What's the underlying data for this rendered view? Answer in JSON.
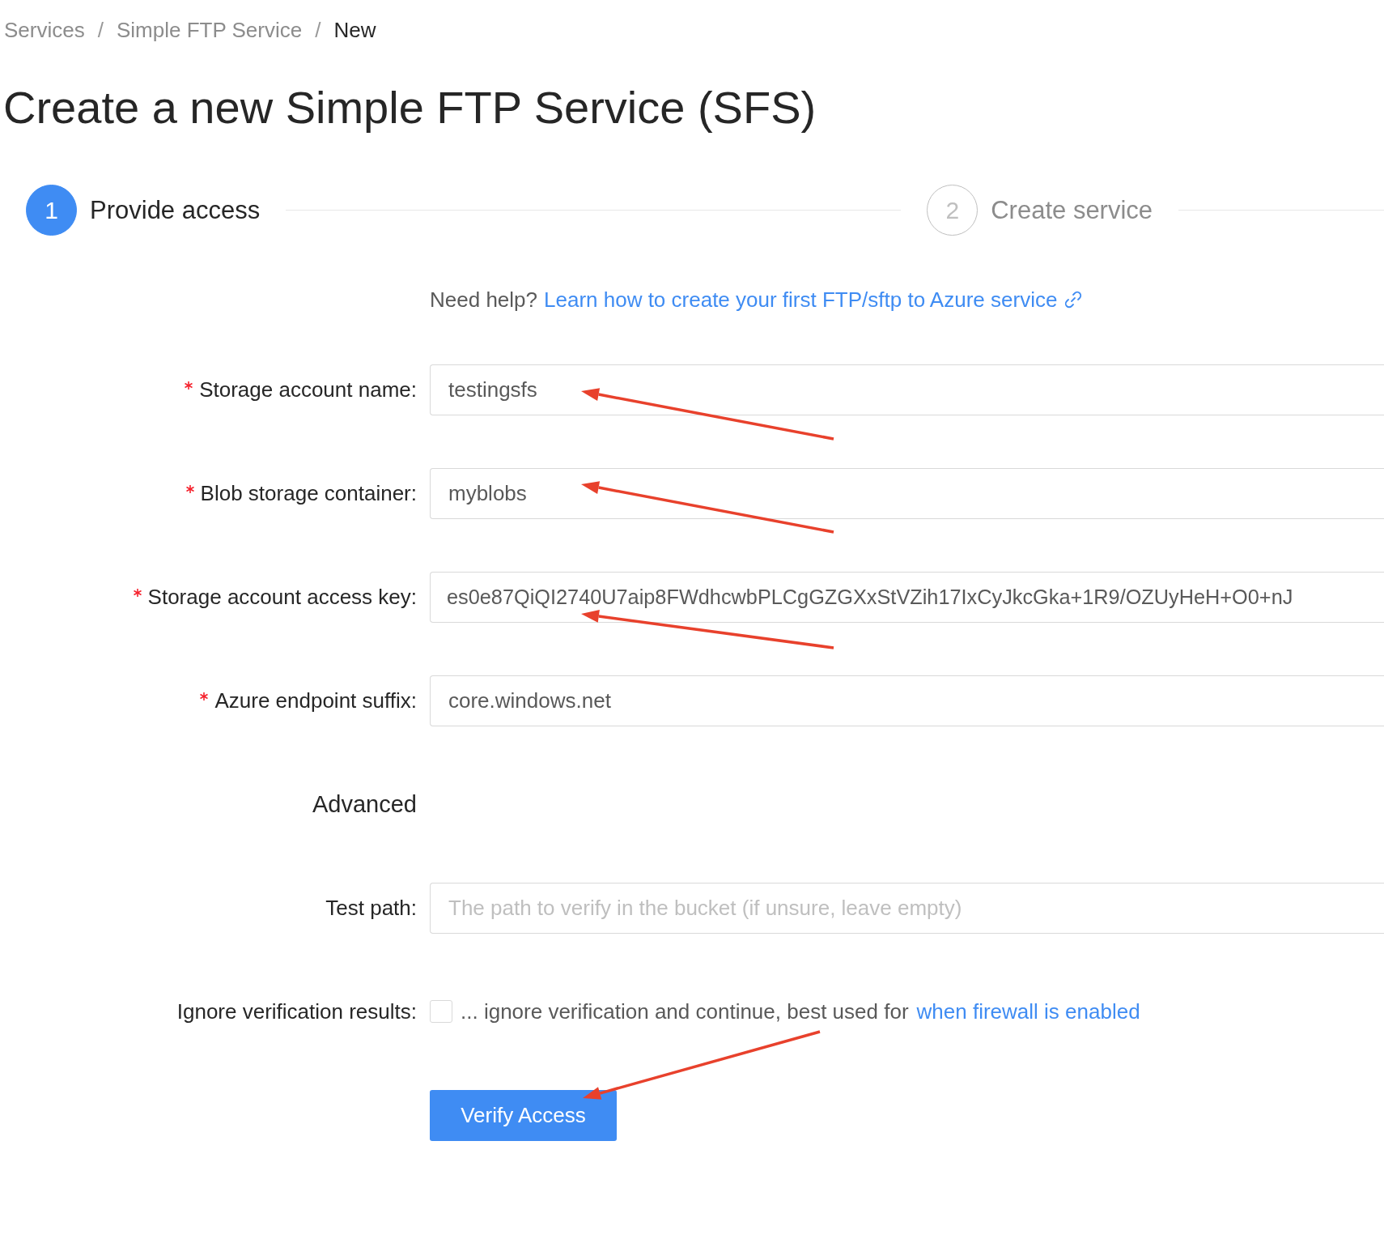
{
  "breadcrumb": [
    {
      "label": "Services",
      "current": false
    },
    {
      "label": "/",
      "kind": "separator"
    },
    {
      "label": "Simple FTP Service",
      "current": false
    },
    {
      "label": "/",
      "kind": "separator"
    },
    {
      "label": "New",
      "current": true
    }
  ],
  "title": "Create a new Simple FTP Service (SFS)",
  "steps": [
    {
      "number": "1",
      "label": "Provide access",
      "active": true
    },
    {
      "number": "2",
      "label": "Create service",
      "active": false
    }
  ],
  "help": {
    "text": "Need help?",
    "link": "Learn how to create your first FTP/sftp to Azure service"
  },
  "fields": [
    {
      "kind": "text",
      "label": "Storage account name:",
      "required": true,
      "value": "testingsfs"
    },
    {
      "kind": "text",
      "label": "Blob storage container:",
      "required": true,
      "value": "myblobs"
    },
    {
      "kind": "text",
      "label": "Storage account access key:",
      "required": true,
      "value": "es0e87QiQI2740U7aip8FWdhcwbPLCgGZGXxStVZih17IxCyJkcGka+1R9/OZUyHeH+O0+nJ"
    },
    {
      "kind": "text",
      "label": "Azure endpoint suffix:",
      "required": true,
      "value": "core.windows.net"
    },
    {
      "kind": "heading",
      "label": "Advanced"
    },
    {
      "kind": "text",
      "label": "Test path:",
      "required": false,
      "placeholder": "The path to verify in the bucket (if unsure, leave empty)"
    },
    {
      "kind": "checkbox",
      "label": "Ignore verification results:",
      "checked": false,
      "text": "... ignore verification and continue, best used for",
      "link": "when firewall is enabled"
    }
  ],
  "button": "Verify Access"
}
